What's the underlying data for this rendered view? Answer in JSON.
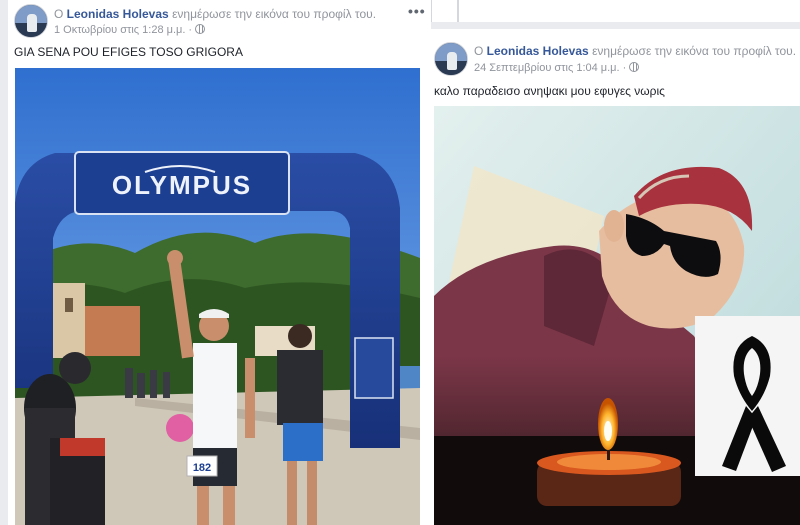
{
  "left_post": {
    "author": "Leonidas Holevas",
    "action": "ενημέρωσε την εικόνα του προφίλ του.",
    "timestamp": "1 Οκτωβρίου στις 1:28 μ.μ.",
    "more_label": "•••",
    "text": "GIA SENA POU EFIGES TOSO GRIGORA",
    "photo": {
      "arch_brand": "OLYMPUS",
      "bib_number": "182"
    }
  },
  "right_post": {
    "author": "Leonidas Holevas",
    "action": "ενημέρωσε την εικόνα του προφίλ του.",
    "timestamp": "24 Σεπτεμβρίου στις 1:04 μ.μ.",
    "text": "καλο παραδεισο ανηψακι μου εφυγες νωρις"
  },
  "icons": {
    "privacy": "globe-icon",
    "more": "more-options-icon",
    "mourning": "black-ribbon-icon",
    "candle": "candle-icon"
  },
  "colors": {
    "link_blue": "#365899",
    "meta_gray": "#90949c",
    "page_bg": "#e9ebee",
    "arch_blue": "#1f3f8f"
  }
}
